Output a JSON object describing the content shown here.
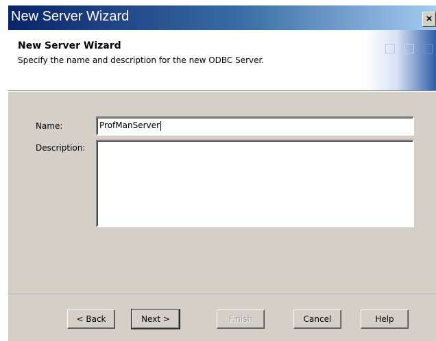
{
  "window": {
    "title": "New Server Wizard",
    "close_label": "×"
  },
  "header": {
    "title": "New Server Wizard",
    "subtitle": "Specify the name and description for the new ODBC Server."
  },
  "form": {
    "name_label": "Name:",
    "name_value": "ProfManServer",
    "description_label": "Description:",
    "description_value": ""
  },
  "buttons": {
    "back": "< Back",
    "next": "Next >",
    "finish": "Finish",
    "cancel": "Cancel",
    "help": "Help"
  }
}
